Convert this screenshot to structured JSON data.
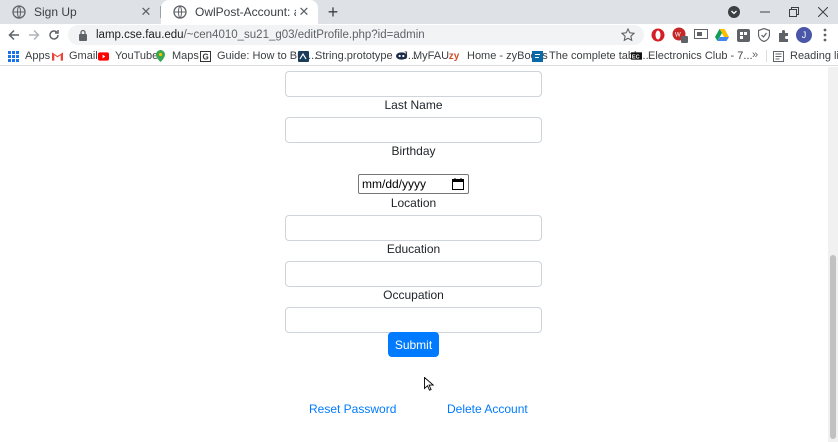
{
  "browser": {
    "tabs": [
      {
        "title": "Sign Up",
        "active": false
      },
      {
        "title": "OwlPost-Account: admin",
        "active": true
      }
    ],
    "url_host": "lamp.cse.fau.edu",
    "url_path": "/~cen4010_su21_g03/editProfile.php?id=admin",
    "avatar_letter": "J",
    "extension_badge": "1"
  },
  "bookmarks": {
    "items": [
      {
        "label": "Apps",
        "icon": "apps-grid-icon"
      },
      {
        "label": "Gmail",
        "icon": "gmail-icon"
      },
      {
        "label": "YouTube",
        "icon": "youtube-icon"
      },
      {
        "label": "Maps",
        "icon": "maps-icon"
      },
      {
        "label": "Guide: How to Buil...",
        "icon": "guide-icon"
      },
      {
        "label": "String.prototype - J...",
        "icon": "mdn-icon"
      },
      {
        "label": "MyFAU",
        "icon": "owl-icon"
      },
      {
        "label": "Home - zyBooks",
        "icon": "zybooks-icon"
      },
      {
        "label": "The complete table...",
        "icon": "table-icon"
      },
      {
        "label": "Electronics Club - 7...",
        "icon": "electronics-icon"
      }
    ],
    "overflow": "»",
    "reading_list": "Reading list"
  },
  "form": {
    "last_name_label": "Last Name",
    "birthday_label": "Birthday",
    "birthday_placeholder": "mm/dd/yyyy",
    "location_label": "Location",
    "education_label": "Education",
    "occupation_label": "Occupation",
    "submit_label": "Submit"
  },
  "links": {
    "reset_password": "Reset Password",
    "delete_account": "Delete Account"
  },
  "colors": {
    "primary": "#007bff",
    "tabstrip": "#dee1e6"
  }
}
